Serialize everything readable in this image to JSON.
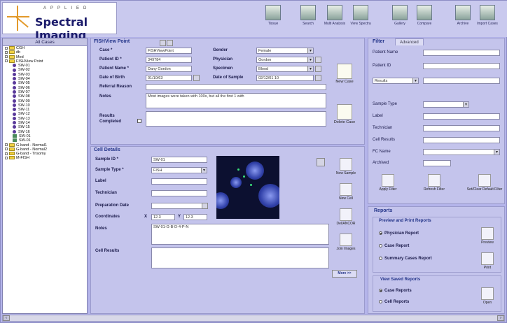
{
  "app": {
    "logo_sub": "APPLIED",
    "logo_name": "Spectral Imaging"
  },
  "toolbar": [
    {
      "label": "Tissue",
      "icon": "tissue-icon"
    },
    {
      "label": "Search",
      "icon": "search-icon"
    },
    {
      "label": "Multi Analysis",
      "icon": "analysis-icon"
    },
    {
      "label": "View Spectra",
      "icon": "spectra-icon"
    },
    {
      "label": "Gallery",
      "icon": "gallery-icon"
    },
    {
      "label": "Compare",
      "icon": "compare-icon"
    },
    {
      "label": "Archive",
      "icon": "archive-icon"
    },
    {
      "label": "Import Cases",
      "icon": "import-icon"
    }
  ],
  "tree": {
    "header": "All Cases",
    "items": [
      {
        "label": "CGH",
        "kind": "folder",
        "indent": 1
      },
      {
        "label": "db",
        "kind": "folder",
        "indent": 1
      },
      {
        "label": "Med",
        "kind": "folder",
        "indent": 1
      },
      {
        "label": "FISHView Point",
        "kind": "folder",
        "indent": 1
      },
      {
        "label": "SW-01",
        "kind": "sample",
        "indent": 2
      },
      {
        "label": "SW-02",
        "kind": "sample",
        "indent": 2
      },
      {
        "label": "SW-03",
        "kind": "sample",
        "indent": 2
      },
      {
        "label": "SW-04",
        "kind": "sample",
        "indent": 2
      },
      {
        "label": "SW-05",
        "kind": "sample",
        "indent": 2
      },
      {
        "label": "SW-06",
        "kind": "sample",
        "indent": 2
      },
      {
        "label": "SW-07",
        "kind": "sample",
        "indent": 2
      },
      {
        "label": "SW-08",
        "kind": "sample",
        "indent": 2
      },
      {
        "label": "SW-09",
        "kind": "sample",
        "indent": 2
      },
      {
        "label": "SW-10",
        "kind": "sample",
        "indent": 2
      },
      {
        "label": "SW-11",
        "kind": "sample",
        "indent": 2
      },
      {
        "label": "SW-12",
        "kind": "sample",
        "indent": 2
      },
      {
        "label": "SW-13",
        "kind": "sample",
        "indent": 2
      },
      {
        "label": "SW-14",
        "kind": "sample",
        "indent": 2
      },
      {
        "label": "SW-15",
        "kind": "sample",
        "indent": 2
      },
      {
        "label": "SW-16",
        "kind": "sample",
        "indent": 2
      },
      {
        "label": "SW-01",
        "kind": "image",
        "indent": 2
      },
      {
        "label": "SW-01",
        "kind": "image",
        "indent": 2
      },
      {
        "label": "G-band - Normal1",
        "kind": "folder",
        "indent": 1
      },
      {
        "label": "G-band - Normal2",
        "kind": "folder",
        "indent": 1
      },
      {
        "label": "G-band - Trisomy",
        "kind": "folder",
        "indent": 1
      },
      {
        "label": "M-FISH",
        "kind": "folder",
        "indent": 1
      }
    ]
  },
  "case": {
    "title": "FISHView Point",
    "case_label": "Case *",
    "case_value": "FISHViewPoint",
    "gender_label": "Gender",
    "gender_value": "Female",
    "patient_id_label": "Patient ID *",
    "patient_id_value": "349784",
    "physician_label": "Physician",
    "physician_value": "Gordon",
    "patient_name_label": "Patient Name *",
    "patient_name_value": "Dany Gordon",
    "specimen_label": "Specimen",
    "specimen_value": "Blood",
    "dob_label": "Date of Birth",
    "dob_value": "01/10/63",
    "dos_label": "Date of Sample",
    "dos_value": "02/12/01 10",
    "referral_label": "Referral Reason",
    "referral_value": "",
    "notes_label": "Notes",
    "notes_value": "Most images were taken with 100x, but all the first 1 with",
    "results_label": "Results",
    "completed_label": "Completed",
    "new_case": "New Case",
    "delete_case": "Delete Case"
  },
  "cell": {
    "title": "Cell Details",
    "sample_id_label": "Sample ID *",
    "sample_id_value": "SW-01",
    "sample_type_label": "Sample Type *",
    "sample_type_value": "FISH",
    "label_label": "Label",
    "label_value": "",
    "technician_label": "Technician",
    "technician_value": "",
    "prep_label": "Preparation Date",
    "prep_value": "",
    "coords_label": "Coordinates",
    "x_label": "X",
    "x_value": "12.3",
    "y_label": "Y",
    "y_value": "12.3",
    "notes_label": "Notes",
    "notes_value": "SW-01-G-B-D-4-P-N",
    "results_label": "Cell Results",
    "results_value": "",
    "buttons": [
      "New Sample",
      "New Cell",
      "Del/ANCOR",
      "Join Images"
    ],
    "more": "More >>"
  },
  "filter": {
    "title": "Filter",
    "tab": "Advanced",
    "fields": [
      "Patient Name",
      "Patient ID"
    ],
    "results_select": "Results",
    "fields2": [
      "Sample Type",
      "Label",
      "Technician",
      "Cell Results",
      "FC Name",
      "Archived"
    ],
    "buttons": [
      "Apply Filter",
      "Refresh Filter",
      "Set/Clear Default Filter"
    ]
  },
  "reports": {
    "title": "Reports",
    "preview_title": "Preview and Print Reports",
    "options": [
      "Physician Report",
      "Case Report",
      "Summary Cases Report"
    ],
    "preview_btn": "Preview",
    "print_btn": "Print",
    "saved_title": "View Saved Reports",
    "saved_options": [
      "Case Reports",
      "Cell Reports"
    ],
    "open_btn": "Open"
  }
}
